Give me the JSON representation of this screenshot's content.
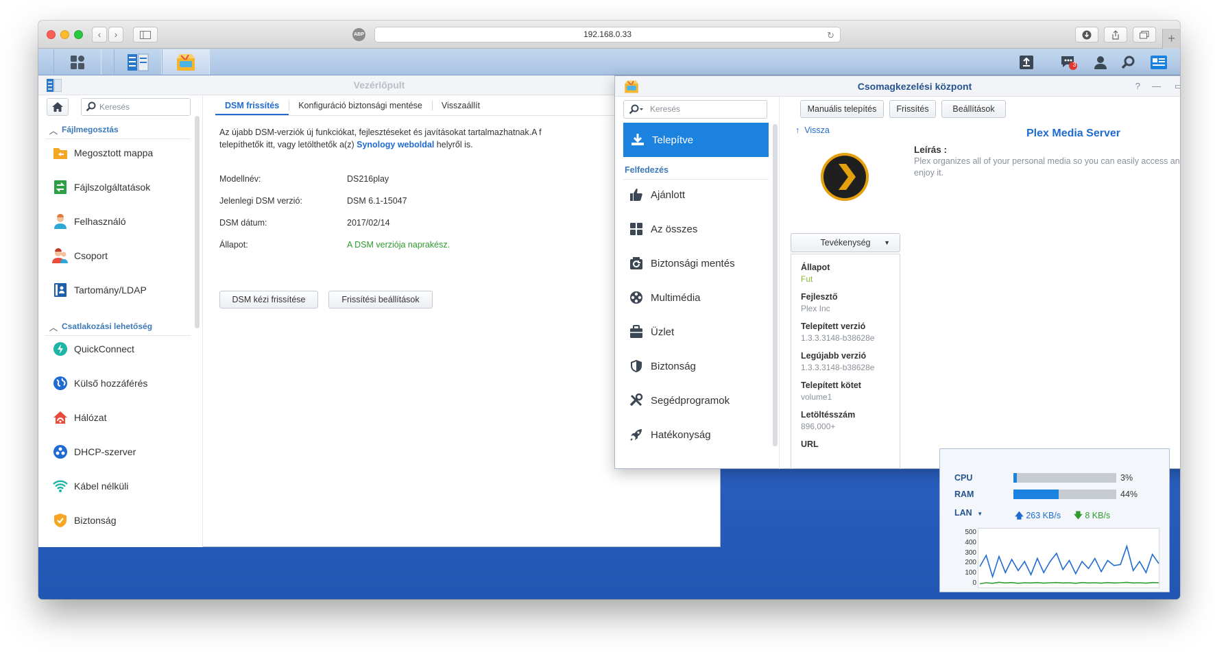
{
  "browser": {
    "url": "192.168.0.33",
    "adblock_label": "ABP"
  },
  "control_panel": {
    "title": "Vezérlőpult",
    "search_placeholder": "Keresés",
    "sections": [
      {
        "label": "Fájlmegosztás"
      },
      {
        "label": "Csatlakozási lehetőség"
      }
    ],
    "items": [
      {
        "label": "Megosztott mappa",
        "icon": "shared-folder-icon"
      },
      {
        "label": "Fájlszolgáltatások",
        "icon": "file-services-icon"
      },
      {
        "label": "Felhasználó",
        "icon": "user-icon"
      },
      {
        "label": "Csoport",
        "icon": "group-icon"
      },
      {
        "label": "Tartomány/LDAP",
        "icon": "domain-ldap-icon"
      },
      {
        "label": "QuickConnect",
        "icon": "quickconnect-icon"
      },
      {
        "label": "Külső hozzáférés",
        "icon": "external-access-icon"
      },
      {
        "label": "Hálózat",
        "icon": "network-icon"
      },
      {
        "label": "DHCP-szerver",
        "icon": "dhcp-icon"
      },
      {
        "label": "Kábel nélküli",
        "icon": "wireless-icon"
      },
      {
        "label": "Biztonság",
        "icon": "security-shield-icon"
      }
    ],
    "tabs": [
      {
        "label": "DSM frissítés"
      },
      {
        "label": "Konfiguráció biztonsági mentése"
      },
      {
        "label": "Visszaállít"
      }
    ],
    "description_line1": "Az újabb DSM-verziók új funkciókat, fejlesztéseket és javításokat tartalmazhatnak.A f",
    "description_line2_prefix": "telepíthetők itt, vagy letölthetők a(z) ",
    "description_link": "Synology weboldal",
    "description_line2_suffix": " helyről is.",
    "info": [
      {
        "key": "Modellnév:",
        "value": "DS216play"
      },
      {
        "key": "Jelenlegi DSM verzió:",
        "value": "DSM 6.1-15047"
      },
      {
        "key": "DSM dátum:",
        "value": "2017/02/14"
      },
      {
        "key": "Állapot:",
        "value": "A DSM verziója naprakész."
      }
    ],
    "buttons": {
      "manual_update": "DSM kézi frissítése",
      "update_settings": "Frissítési beállítások"
    }
  },
  "package_center": {
    "title": "Csomagkezelési központ",
    "search_placeholder": "Keresés",
    "installed_label": "Telepítve",
    "discover_label": "Felfedezés",
    "items": [
      {
        "label": "Ajánlott",
        "icon": "thumbs-up-icon"
      },
      {
        "label": "Az összes",
        "icon": "grid-icon"
      },
      {
        "label": "Biztonsági mentés",
        "icon": "backup-icon"
      },
      {
        "label": "Multimédia",
        "icon": "film-reel-icon"
      },
      {
        "label": "Üzlet",
        "icon": "briefcase-icon"
      },
      {
        "label": "Biztonság",
        "icon": "shield-icon"
      },
      {
        "label": "Segédprogramok",
        "icon": "tools-icon"
      },
      {
        "label": "Hatékonyság",
        "icon": "rocket-icon"
      }
    ],
    "toolbar": {
      "manual_install": "Manuális telepítés",
      "refresh": "Frissítés",
      "settings": "Beállítások"
    },
    "back_label": "Vissza",
    "package_name": "Plex Media Server",
    "description_heading": "Leírás :",
    "description_text": "Plex organizes all of your personal media so you can easily access and enjoy it.",
    "action_label": "Tevékenység",
    "details": [
      {
        "key": "Állapot",
        "value": "Fut"
      },
      {
        "key": "Fejlesztő",
        "value": "Plex Inc"
      },
      {
        "key": "Telepített verzió",
        "value": "1.3.3.3148-b38628e"
      },
      {
        "key": "Legújabb verzió",
        "value": "1.3.3.3148-b38628e"
      },
      {
        "key": "Telepített kötet",
        "value": "volume1"
      },
      {
        "key": "Letöltésszám",
        "value": "896,000+"
      },
      {
        "key": "URL",
        "value": ""
      }
    ]
  },
  "taskbar": {
    "notification_count": "3"
  },
  "resource_monitor": {
    "cpu_label": "CPU",
    "cpu_percent": 3,
    "cpu_text": "3%",
    "ram_label": "RAM",
    "ram_percent": 44,
    "ram_text": "44%",
    "lan_label": "LAN",
    "upload": "263 KB/s",
    "download": "8 KB/s",
    "chart_data": {
      "type": "line",
      "ylim": [
        0,
        500
      ],
      "yticks": [
        "500",
        "400",
        "300",
        "200",
        "100",
        "0"
      ],
      "series": [
        {
          "values": [
            180,
            290,
            80,
            280,
            120,
            250,
            140,
            230,
            100,
            260,
            120,
            230,
            310,
            150,
            240,
            110,
            230,
            160,
            260,
            130,
            240,
            190,
            200,
            380,
            140,
            230,
            120,
            300,
            210
          ]
        },
        {
          "values": [
            10,
            20,
            15,
            25,
            18,
            22,
            15,
            20,
            18,
            22,
            16,
            20,
            22,
            18,
            20,
            15,
            22,
            18,
            20,
            16,
            22,
            18,
            20,
            24,
            18,
            20,
            16,
            22,
            20
          ]
        }
      ]
    }
  },
  "colors": {
    "accent": "#1b82e0",
    "link": "#1f6bd1",
    "ok_green": "#2e9c2e",
    "upload": "#1f6bd1",
    "download": "#2e9c2e"
  }
}
